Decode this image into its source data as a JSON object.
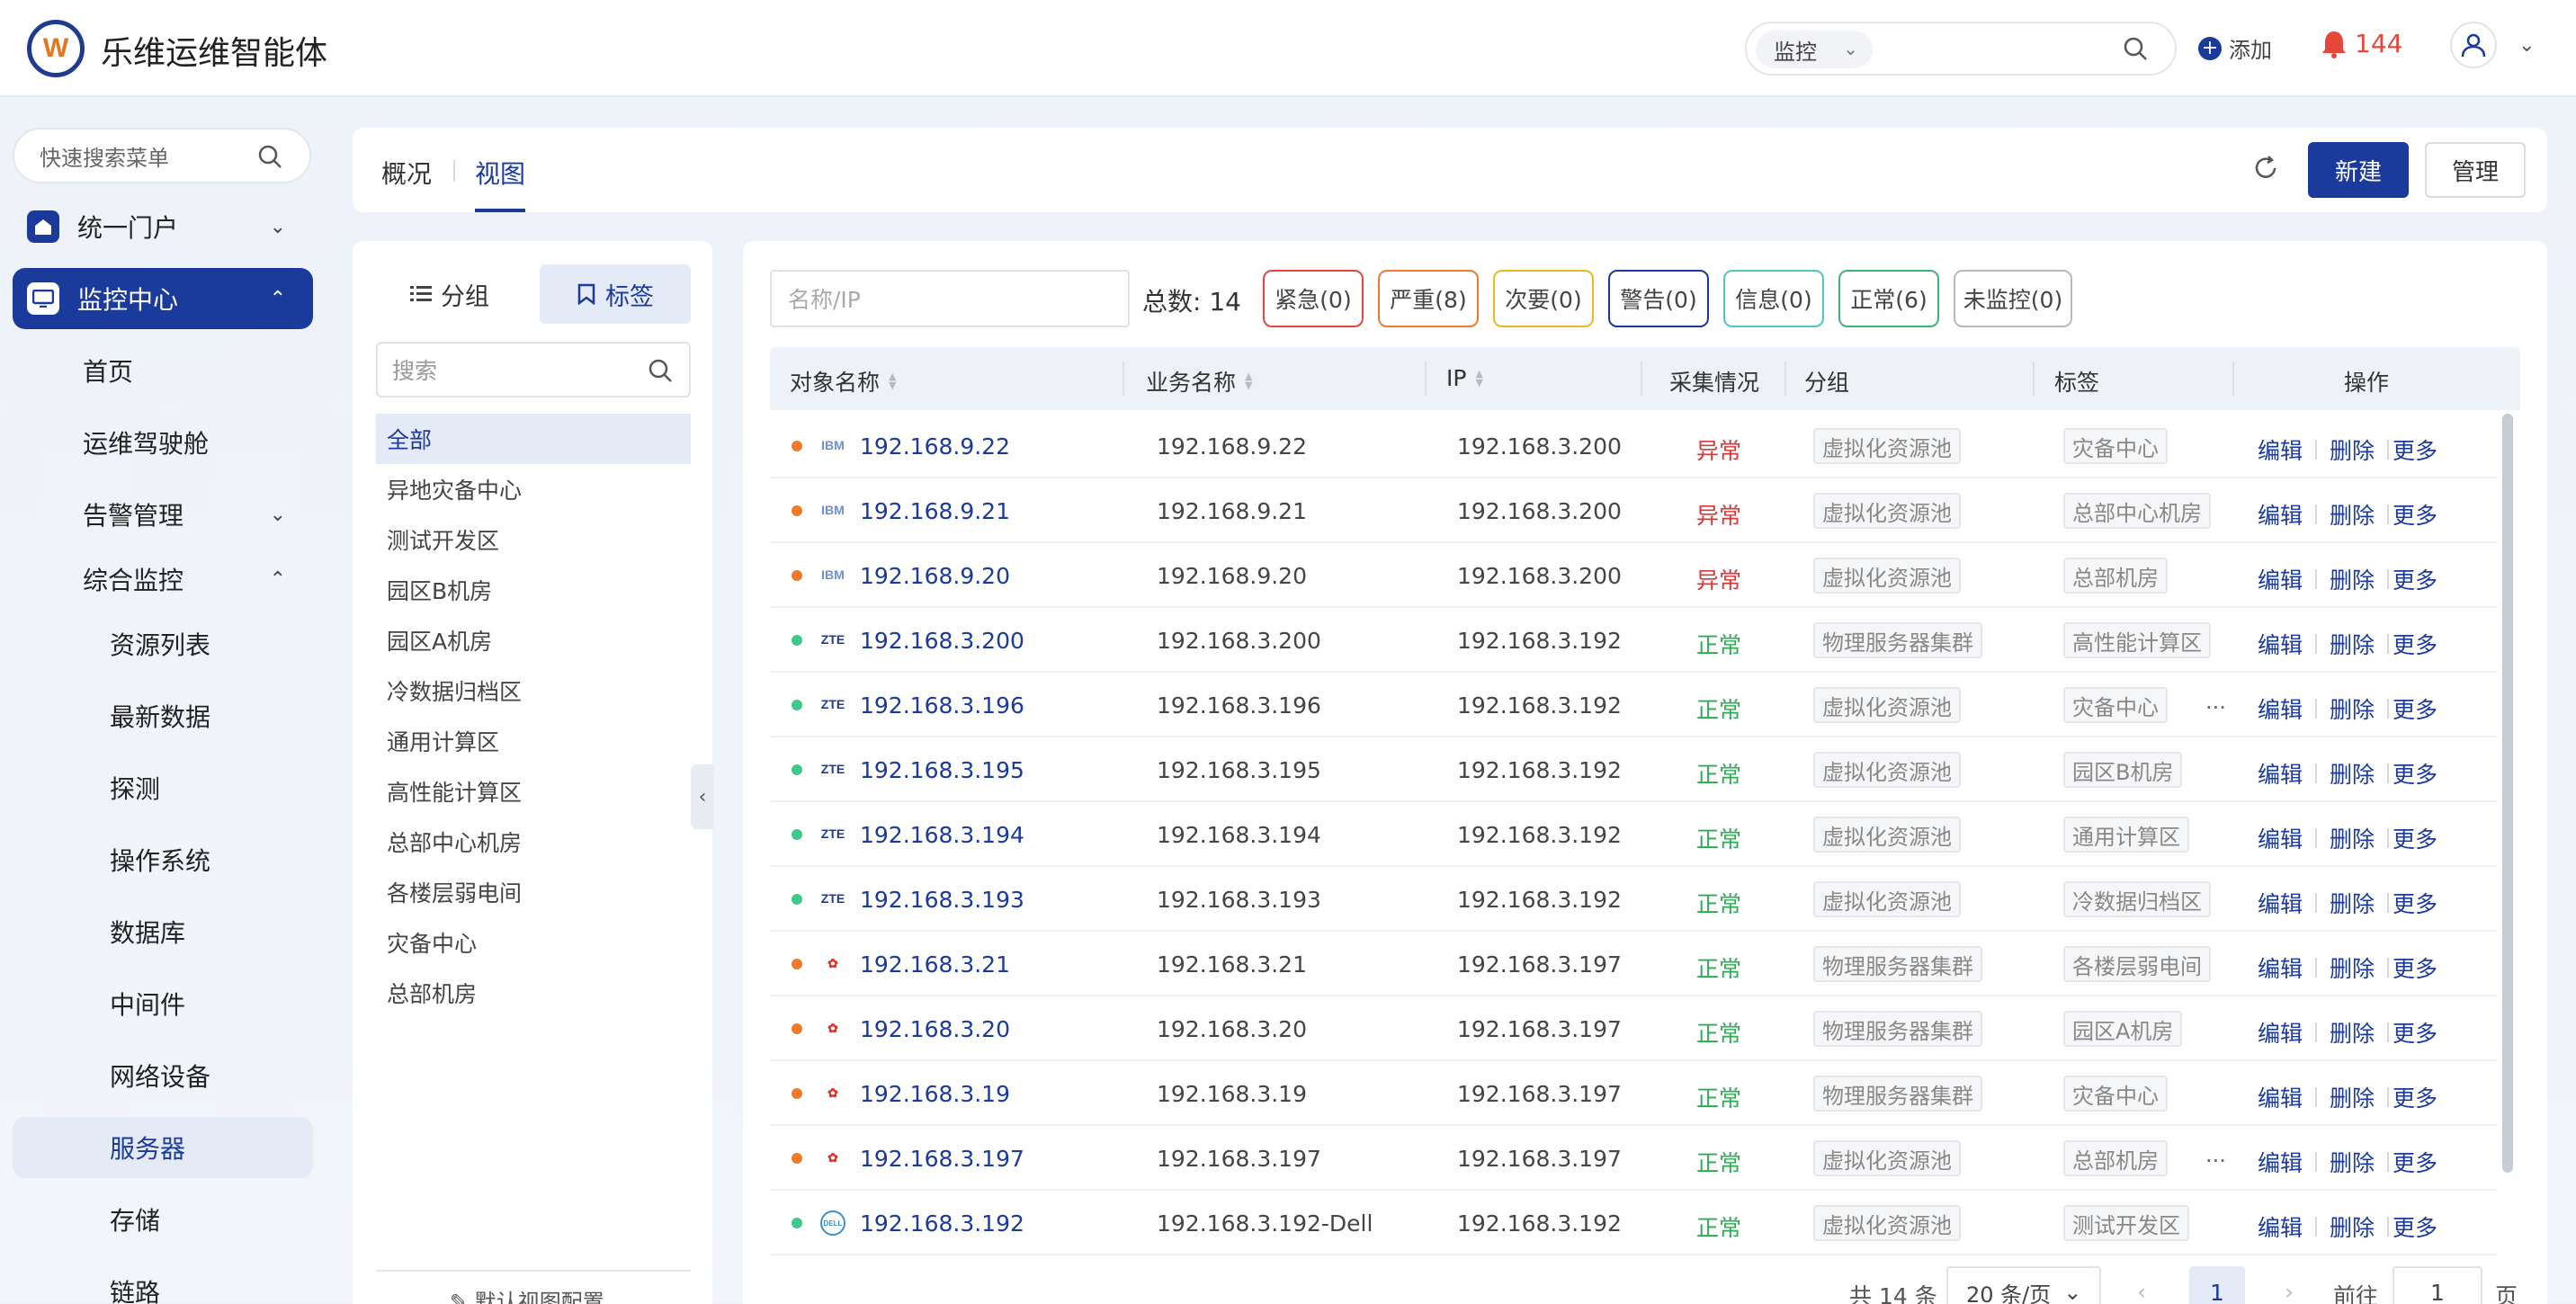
{
  "header": {
    "title": "乐维运维智能体",
    "search_scope": "监控",
    "add_label": "添加",
    "alert_count": "144"
  },
  "sidebar": {
    "search_placeholder": "快速搜索菜单",
    "items": [
      {
        "label": "统一门户"
      },
      {
        "label": "监控中心"
      },
      {
        "label": "首页"
      },
      {
        "label": "运维驾驶舱"
      },
      {
        "label": "告警管理"
      },
      {
        "label": "综合监控"
      },
      {
        "label": "资源列表"
      },
      {
        "label": "最新数据"
      },
      {
        "label": "探测"
      },
      {
        "label": "操作系统"
      },
      {
        "label": "数据库"
      },
      {
        "label": "中间件"
      },
      {
        "label": "网络设备"
      },
      {
        "label": "服务器"
      },
      {
        "label": "存储"
      },
      {
        "label": "链路"
      }
    ]
  },
  "tabs": {
    "overview": "概况",
    "view": "视图",
    "new_button": "新建",
    "manage_button": "管理"
  },
  "tagpanel": {
    "group_label": "分组",
    "tag_label": "标签",
    "search_placeholder": "搜索",
    "tags": [
      "全部",
      "异地灾备中心",
      "测试开发区",
      "园区B机房",
      "园区A机房",
      "冷数据归档区",
      "通用计算区",
      "高性能计算区",
      "总部中心机房",
      "各楼层弱电间",
      "灾备中心",
      "总部机房"
    ],
    "footer": "默认视图配置"
  },
  "filters": {
    "name_placeholder": "名称/IP",
    "total_label": "总数:",
    "total_value": "14",
    "chips": [
      {
        "label": "紧急(0)",
        "color": "#e5483b"
      },
      {
        "label": "严重(8)",
        "color": "#f07a2b"
      },
      {
        "label": "次要(0)",
        "color": "#e8b91f"
      },
      {
        "label": "警告(0)",
        "color": "#1a3a9c"
      },
      {
        "label": "信息(0)",
        "color": "#4fc9c0"
      },
      {
        "label": "正常(6)",
        "color": "#3fb27a"
      },
      {
        "label": "未监控(0)",
        "color": "#b5b9c2"
      }
    ]
  },
  "table": {
    "columns": [
      "对象名称",
      "业务名称",
      "IP",
      "采集情况",
      "分组",
      "标签",
      "操作"
    ],
    "rows": [
      {
        "name": "192.168.9.22",
        "biz": "192.168.9.22",
        "ip": "192.168.3.200",
        "status": "异常",
        "group": "虚拟化资源池",
        "tag": "灾备中心",
        "brand": "IBM",
        "dot": "#f07a2b",
        "more_tags": ""
      },
      {
        "name": "192.168.9.21",
        "biz": "192.168.9.21",
        "ip": "192.168.3.200",
        "status": "异常",
        "group": "虚拟化资源池",
        "tag": "总部中心机房",
        "brand": "IBM",
        "dot": "#f07a2b",
        "more_tags": ""
      },
      {
        "name": "192.168.9.20",
        "biz": "192.168.9.20",
        "ip": "192.168.3.200",
        "status": "异常",
        "group": "虚拟化资源池",
        "tag": "总部机房",
        "brand": "IBM",
        "dot": "#f07a2b",
        "more_tags": ""
      },
      {
        "name": "192.168.3.200",
        "biz": "192.168.3.200",
        "ip": "192.168.3.192",
        "status": "正常",
        "group": "物理服务器集群",
        "tag": "高性能计算区",
        "brand": "ZTE",
        "dot": "#3fc989",
        "more_tags": ""
      },
      {
        "name": "192.168.3.196",
        "biz": "192.168.3.196",
        "ip": "192.168.3.192",
        "status": "正常",
        "group": "虚拟化资源池",
        "tag": "灾备中心",
        "brand": "ZTE",
        "dot": "#3fc989",
        "more_tags": "..."
      },
      {
        "name": "192.168.3.195",
        "biz": "192.168.3.195",
        "ip": "192.168.3.192",
        "status": "正常",
        "group": "虚拟化资源池",
        "tag": "园区B机房",
        "brand": "ZTE",
        "dot": "#3fc989",
        "more_tags": ""
      },
      {
        "name": "192.168.3.194",
        "biz": "192.168.3.194",
        "ip": "192.168.3.192",
        "status": "正常",
        "group": "虚拟化资源池",
        "tag": "通用计算区",
        "brand": "ZTE",
        "dot": "#3fc989",
        "more_tags": ""
      },
      {
        "name": "192.168.3.193",
        "biz": "192.168.3.193",
        "ip": "192.168.3.192",
        "status": "正常",
        "group": "虚拟化资源池",
        "tag": "冷数据归档区",
        "brand": "ZTE",
        "dot": "#3fc989",
        "more_tags": ""
      },
      {
        "name": "192.168.3.21",
        "biz": "192.168.3.21",
        "ip": "192.168.3.197",
        "status": "正常",
        "group": "物理服务器集群",
        "tag": "各楼层弱电间",
        "brand": "HUAWEI",
        "dot": "#f07a2b",
        "more_tags": ""
      },
      {
        "name": "192.168.3.20",
        "biz": "192.168.3.20",
        "ip": "192.168.3.197",
        "status": "正常",
        "group": "物理服务器集群",
        "tag": "园区A机房",
        "brand": "HUAWEI",
        "dot": "#f07a2b",
        "more_tags": ""
      },
      {
        "name": "192.168.3.19",
        "biz": "192.168.3.19",
        "ip": "192.168.3.197",
        "status": "正常",
        "group": "物理服务器集群",
        "tag": "灾备中心",
        "brand": "HUAWEI",
        "dot": "#f07a2b",
        "more_tags": ""
      },
      {
        "name": "192.168.3.197",
        "biz": "192.168.3.197",
        "ip": "192.168.3.197",
        "status": "正常",
        "group": "虚拟化资源池",
        "tag": "总部机房",
        "brand": "HUAWEI",
        "dot": "#f07a2b",
        "more_tags": "..."
      },
      {
        "name": "192.168.3.192",
        "biz": "192.168.3.192-Dell",
        "ip": "192.168.3.192",
        "status": "正常",
        "group": "虚拟化资源池",
        "tag": "测试开发区",
        "brand": "DELL",
        "dot": "#3fc989",
        "more_tags": ""
      }
    ],
    "ops": {
      "edit": "编辑",
      "delete": "删除",
      "more": "更多"
    }
  },
  "pager": {
    "total": "共 14 条",
    "page_size": "20 条/页",
    "current": "1",
    "goto_label": "前往",
    "goto_value": "1",
    "page_suffix": "页"
  }
}
